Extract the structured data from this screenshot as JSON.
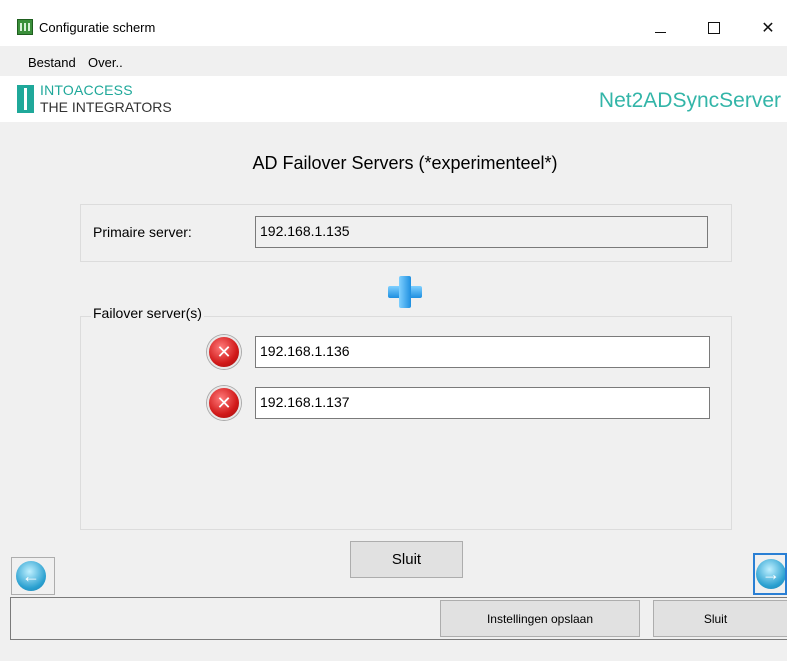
{
  "window": {
    "title": "Configuratie scherm",
    "icon": "app-grid-icon",
    "controls": {
      "minimize": "minimize-icon",
      "maximize": "maximize-icon",
      "close": "close-icon"
    }
  },
  "menu": {
    "items": [
      {
        "label": "Bestand"
      },
      {
        "label": "Over.."
      }
    ]
  },
  "header": {
    "logo_line1": "INTOACCESS",
    "logo_line2": "THE INTEGRATORS",
    "product": "Net2ADSyncServer",
    "accent_color": "#1fa89a"
  },
  "main": {
    "title": "AD Failover Servers (*experimenteel*)",
    "primary": {
      "label": "Primaire server:",
      "value": "192.168.1.135"
    },
    "add_icon": "plus-icon",
    "failover": {
      "legend": "Failover server(s)",
      "servers": [
        {
          "value": "192.168.1.136",
          "remove_icon": "remove-icon"
        },
        {
          "value": "192.168.1.137",
          "remove_icon": "remove-icon"
        }
      ]
    },
    "close_label": "Sluit"
  },
  "navigation": {
    "back_icon": "arrow-left-icon",
    "forward_icon": "arrow-right-icon"
  },
  "footer": {
    "save_label": "Instellingen opslaan",
    "close_label": "Sluit"
  }
}
